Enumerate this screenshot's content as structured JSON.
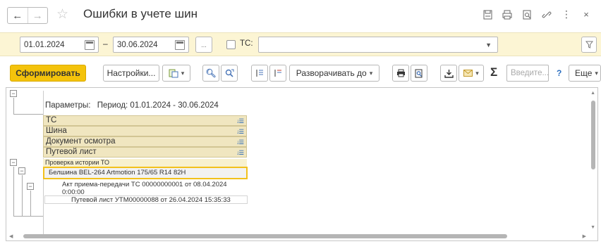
{
  "window": {
    "title": "Ошибки в учете шин"
  },
  "filters": {
    "date_from": "01.01.2024",
    "date_dash": "–",
    "date_to": "30.06.2024",
    "ellipsis": "...",
    "tc_label": "ТС:",
    "tc_value": ""
  },
  "toolbar": {
    "generate": "Сформировать",
    "settings": "Настройки...",
    "expand_to": "Разворачивать до",
    "search_placeholder": "Введите...",
    "help": "?",
    "more": "Еще"
  },
  "report": {
    "params_label": "Параметры:",
    "params_value": "Период: 01.01.2024 - 30.06.2024",
    "groupings": [
      "ТС",
      "Шина",
      "Документ осмотра",
      "Путевой лист"
    ],
    "check_header": "Проверка  истории ТО",
    "tire": "Белшина BEL-264 Artmotion 175/65 R14 82H",
    "act_line1": "Акт приема-передачи ТС 00000000001 от 08.04.2024",
    "act_line2": "0:00:00",
    "waybill": "Путевой лист УТМ00000088 от 26.04.2024 15:35:33"
  },
  "colors": {
    "primary_button": "#f4c30b",
    "filter_bar": "#fcf5d4",
    "group_row": "#f0e6c0",
    "highlight_border": "#f2c11c"
  }
}
